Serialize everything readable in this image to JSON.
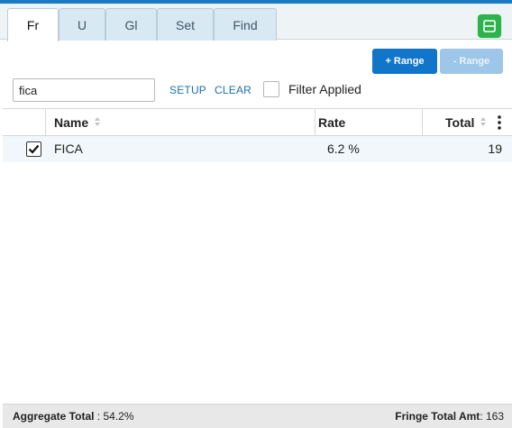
{
  "tabs": [
    {
      "label": "Fr",
      "active": true
    },
    {
      "label": "U",
      "active": false
    },
    {
      "label": "Gl",
      "active": false
    },
    {
      "label": "Set",
      "active": false
    },
    {
      "label": "Find",
      "active": false
    }
  ],
  "toolbar": {
    "add_range_label": "+ Range",
    "remove_range_label": "- Range",
    "collapse_icon": "collapse-panel-icon"
  },
  "filter": {
    "search_value": "fica",
    "setup_label": "SETUP",
    "clear_label": "CLEAR",
    "filter_applied_label": "Filter Applied",
    "filter_applied_checked": false
  },
  "table": {
    "columns": [
      "Name",
      "Rate",
      "Total"
    ],
    "rows": [
      {
        "checked": true,
        "name": "FICA",
        "rate": "6.2 %",
        "total": "19"
      }
    ]
  },
  "footer": {
    "aggregate_label": "Aggregate Total",
    "aggregate_value": ": 54.2%",
    "fringe_label": "Fringe Total Amt",
    "fringe_value": ": 163"
  },
  "colors": {
    "accent": "#1a7ac4",
    "primary_button": "#1175c9",
    "disabled_button": "#9ec6e8",
    "collapse_button": "#2db24c",
    "link": "#1a6fb5"
  }
}
